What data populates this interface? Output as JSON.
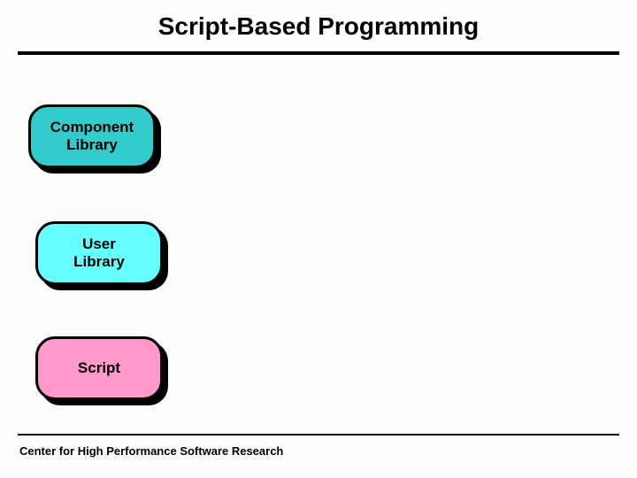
{
  "title": "Script-Based Programming",
  "footer": "Center for High Performance Software Research",
  "blocks": [
    {
      "id": "b1",
      "label": "Component\nLibrary",
      "fill": "#33cccc"
    },
    {
      "id": "b2",
      "label": "User\nLibrary",
      "fill": "#66ffff"
    },
    {
      "id": "b3",
      "label": "Script",
      "fill": "#ff99cc"
    }
  ]
}
